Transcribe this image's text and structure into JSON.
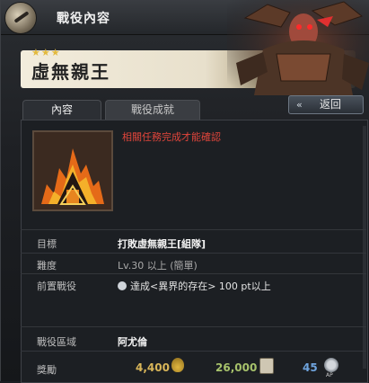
{
  "window": {
    "title": "戰役內容",
    "stars": "★★★",
    "boss_name": "虛無親王"
  },
  "tabs": [
    {
      "label": "內容",
      "active": true
    },
    {
      "label": "戰役成就",
      "active": false
    }
  ],
  "back_button": {
    "label": "返回",
    "arrow": "«"
  },
  "requirement_note": "相關任務完成才能確認",
  "details": {
    "target_label": "目標",
    "target_value": "打敗虛無親王[組隊]",
    "difficulty_label": "難度",
    "difficulty_value": "Lv.30 以上 (簡單)",
    "prereq_label": "前置戰役",
    "prereq_value": "達成<異界的存在> 100 pt以上",
    "area_label": "戰役區域",
    "area_value": "阿尤倫",
    "reward_label": "獎勵"
  },
  "rewards": {
    "money": "4,400",
    "exp": "26,000",
    "ap": "45",
    "ap_icon_label": "AP"
  },
  "colors": {
    "accent_red": "#e0453b",
    "star_gold": "#e2b93c",
    "money_gold": "#d9b659",
    "exp_green": "#a7c26b",
    "ap_blue": "#6fa4de"
  },
  "icons": [
    "campaign-emblem-icon",
    "burning-house-icon",
    "info-icon",
    "money-bag-icon",
    "exp-scroll-icon",
    "ap-medal-icon"
  ]
}
